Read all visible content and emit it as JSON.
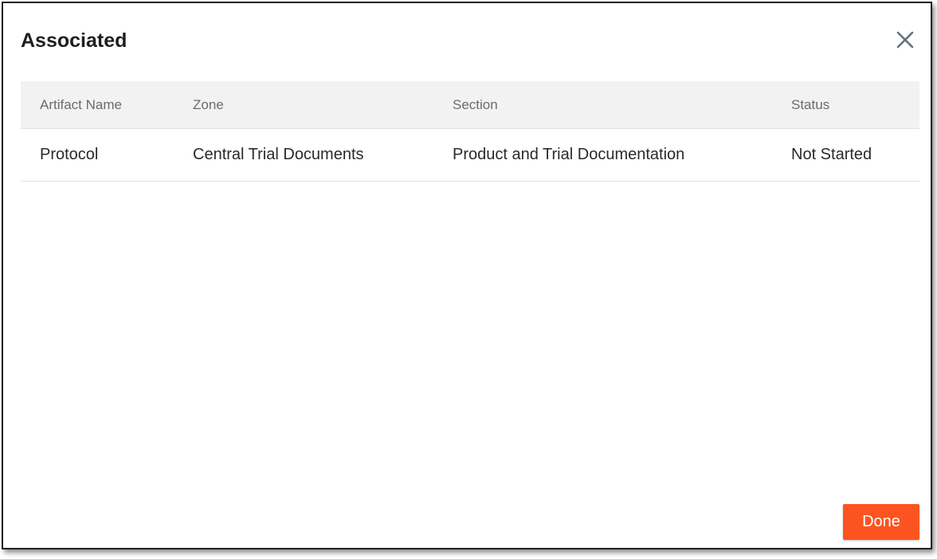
{
  "dialog": {
    "title": "Associated",
    "close_icon": "close-icon",
    "done_label": "Done"
  },
  "table": {
    "columns": [
      "Artifact Name",
      "Zone",
      "Section",
      "Status"
    ],
    "rows": [
      [
        "Protocol",
        "Central Trial Documents",
        "Product and Trial Documentation",
        "Not Started"
      ]
    ]
  },
  "colors": {
    "accent": "#fc5421",
    "header_bg": "#f2f2f2",
    "close_icon": "#5f7580"
  }
}
